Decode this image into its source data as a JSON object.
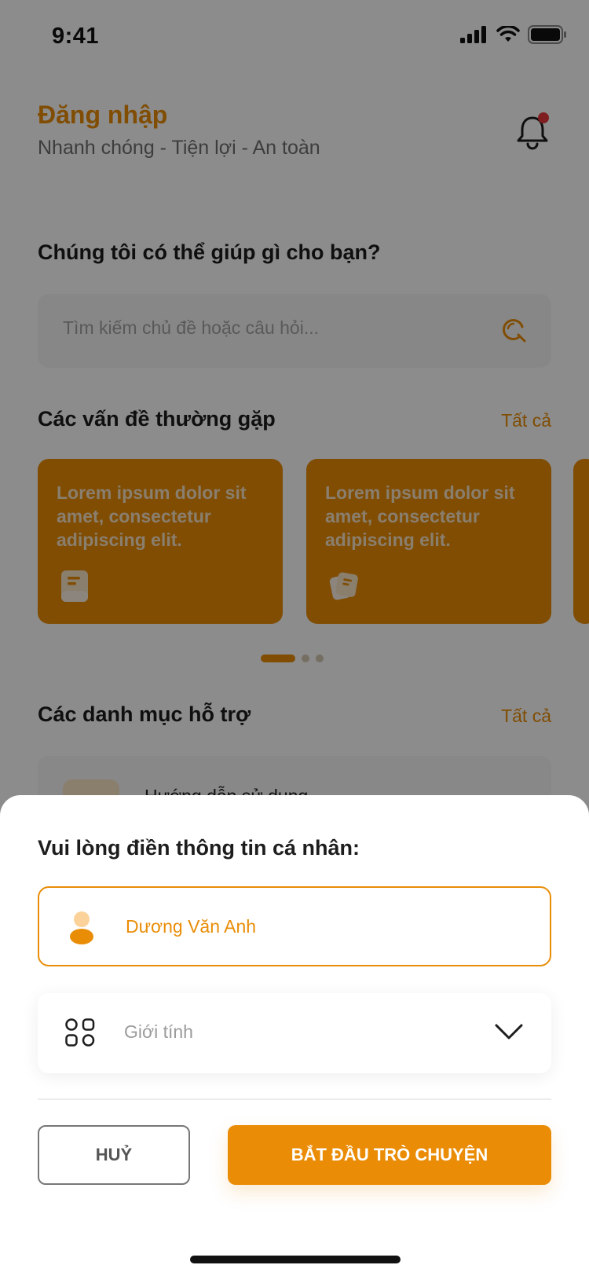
{
  "status_bar": {
    "time": "9:41"
  },
  "header": {
    "title": "Đăng nhập",
    "subtitle": "Nhanh chóng - Tiện lợi - An toàn"
  },
  "help": {
    "title": "Chúng tôi có thể giúp gì cho bạn?",
    "search_placeholder": "Tìm kiếm chủ đề hoặc câu hỏi..."
  },
  "faq": {
    "title": "Các vấn đề thường gặp",
    "see_all": "Tất cả",
    "cards": [
      {
        "text": "Lorem ipsum dolor sit amet, consectetur adipiscing elit.",
        "icon": "document-icon"
      },
      {
        "text": "Lorem ipsum dolor sit amet, consectetur adipiscing elit.",
        "icon": "documents-icon"
      }
    ],
    "carousel": {
      "active_index": 0,
      "count": 3
    }
  },
  "categories": {
    "title": "Các danh mục hỗ trợ",
    "see_all": "Tất cả",
    "items": [
      {
        "label": "Hướng dẫn sử dụng"
      }
    ]
  },
  "sheet": {
    "title": "Vui lòng điền thông tin cá nhân:",
    "name_value": "Dương Văn Anh",
    "gender_placeholder": "Giới tính",
    "cancel_label": "HUỶ",
    "start_label": "BẮT ĐẦU TRÒ CHUYỆN"
  },
  "colors": {
    "accent": "#E98D07",
    "notification": "#E5383B"
  }
}
